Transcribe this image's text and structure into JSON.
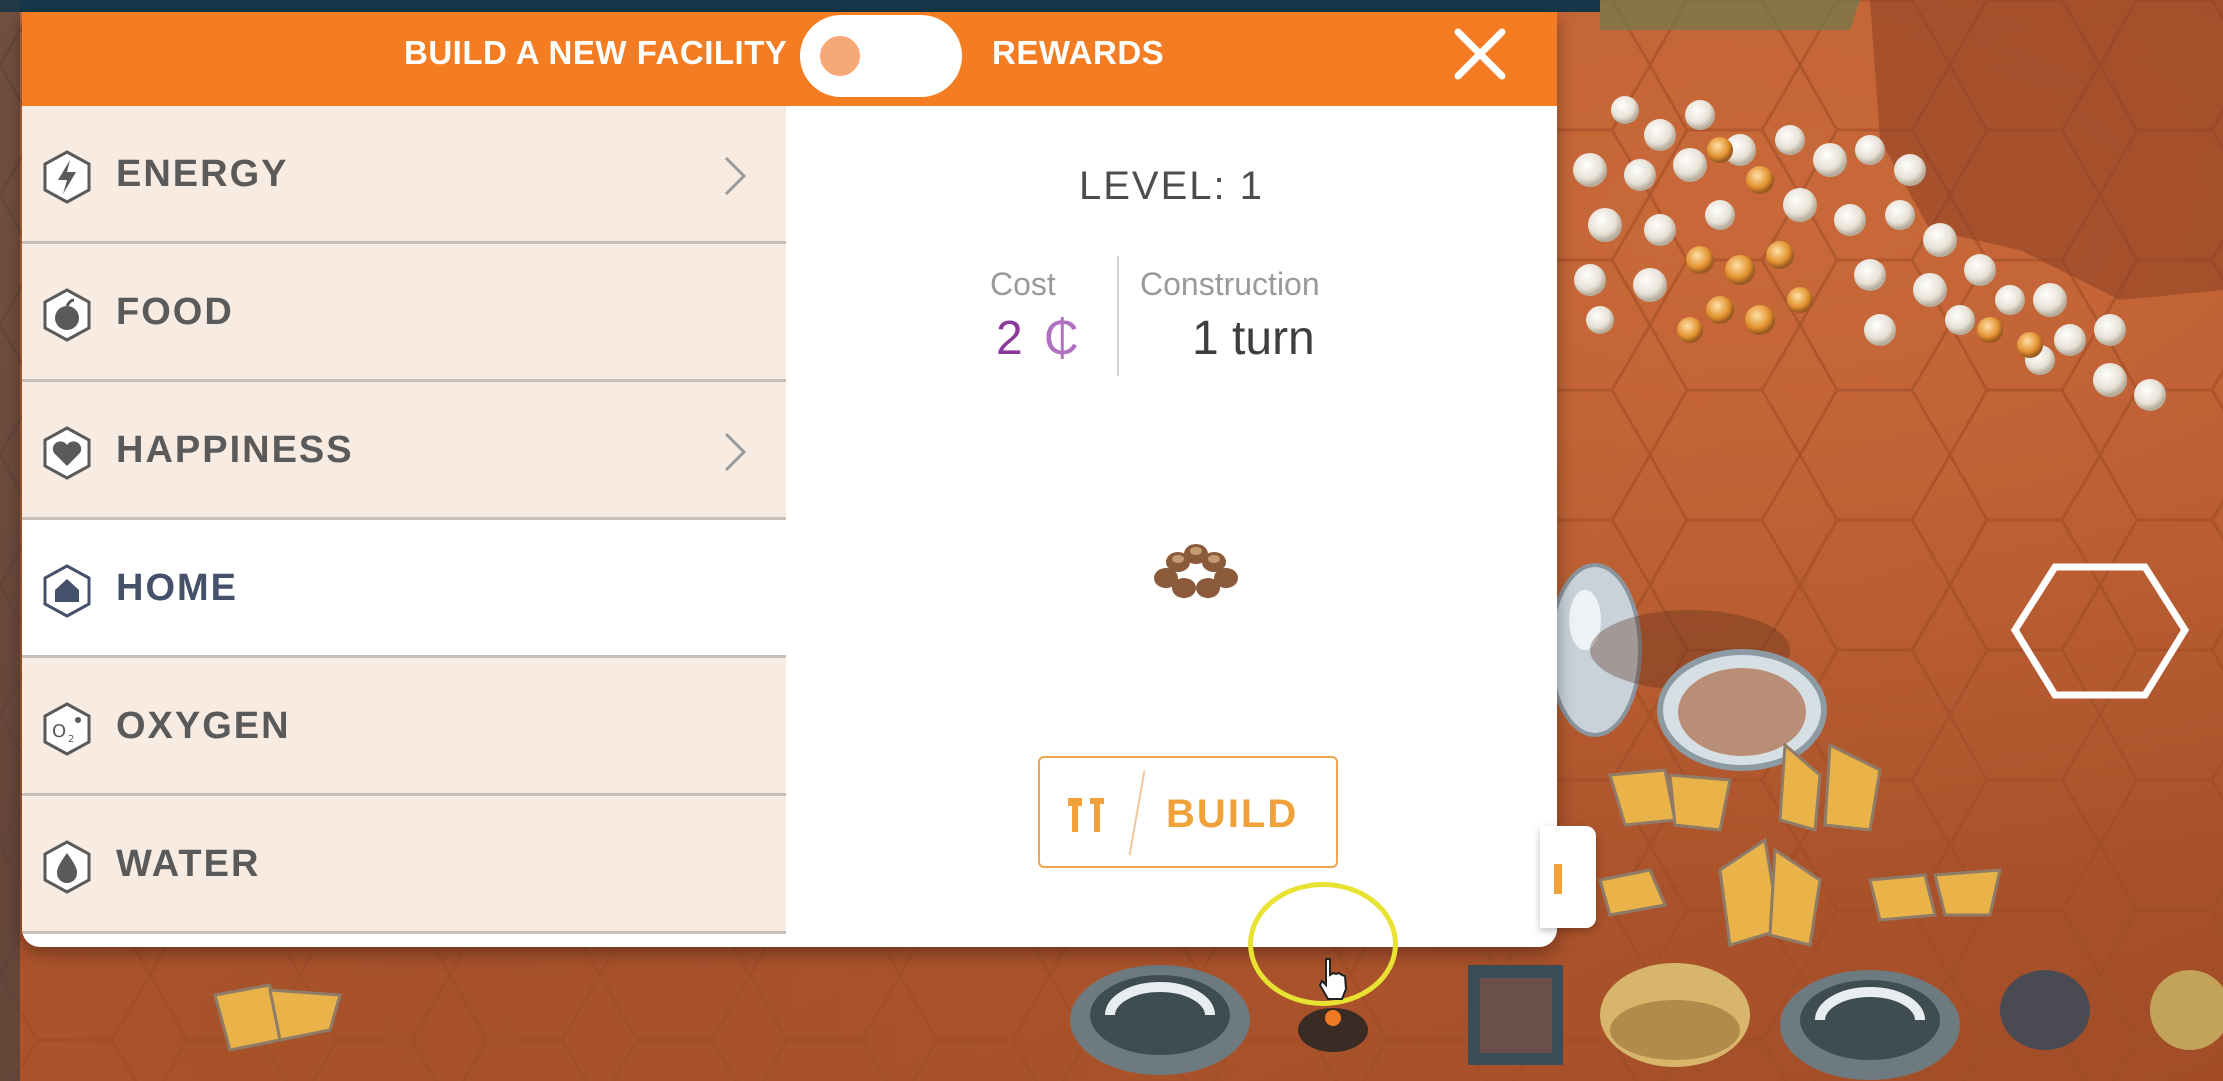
{
  "header": {
    "build_label": "BUILD A NEW FACILITY",
    "rewards_label": "REWARDS",
    "toggle_state": "build",
    "close_icon": "close-icon"
  },
  "categories": [
    {
      "label": "ENERGY",
      "icon": "lightning-icon",
      "has_chevron": true
    },
    {
      "label": "FOOD",
      "icon": "apple-icon",
      "has_chevron": false
    },
    {
      "label": "HAPPINESS",
      "icon": "heart-icon",
      "has_chevron": true
    },
    {
      "label": "HOME",
      "icon": "home-icon",
      "has_chevron": false,
      "selected": true
    },
    {
      "label": "OXYGEN",
      "icon": "oxygen-icon",
      "has_chevron": false
    },
    {
      "label": "WATER",
      "icon": "water-drop-icon",
      "has_chevron": false
    }
  ],
  "detail": {
    "level_text": "LEVEL: 1",
    "cost_label": "Cost",
    "cost_value": "2",
    "cost_currency": "₵",
    "construction_label": "Construction",
    "construction_value": "1 turn",
    "preview_icon": "habitat-cluster-icon",
    "build_label": "BUILD",
    "build_icon": "build-tools-icon"
  },
  "colors": {
    "accent": "#f47c22",
    "panel_bg": "#ffffff",
    "category_bg": "#f8ece2",
    "category_text": "#5a5a5a",
    "cost_color": "#8a3a9a",
    "build_color": "#f0a13a",
    "terrain": "#b5582e",
    "highlight_ring": "#e8e233"
  }
}
